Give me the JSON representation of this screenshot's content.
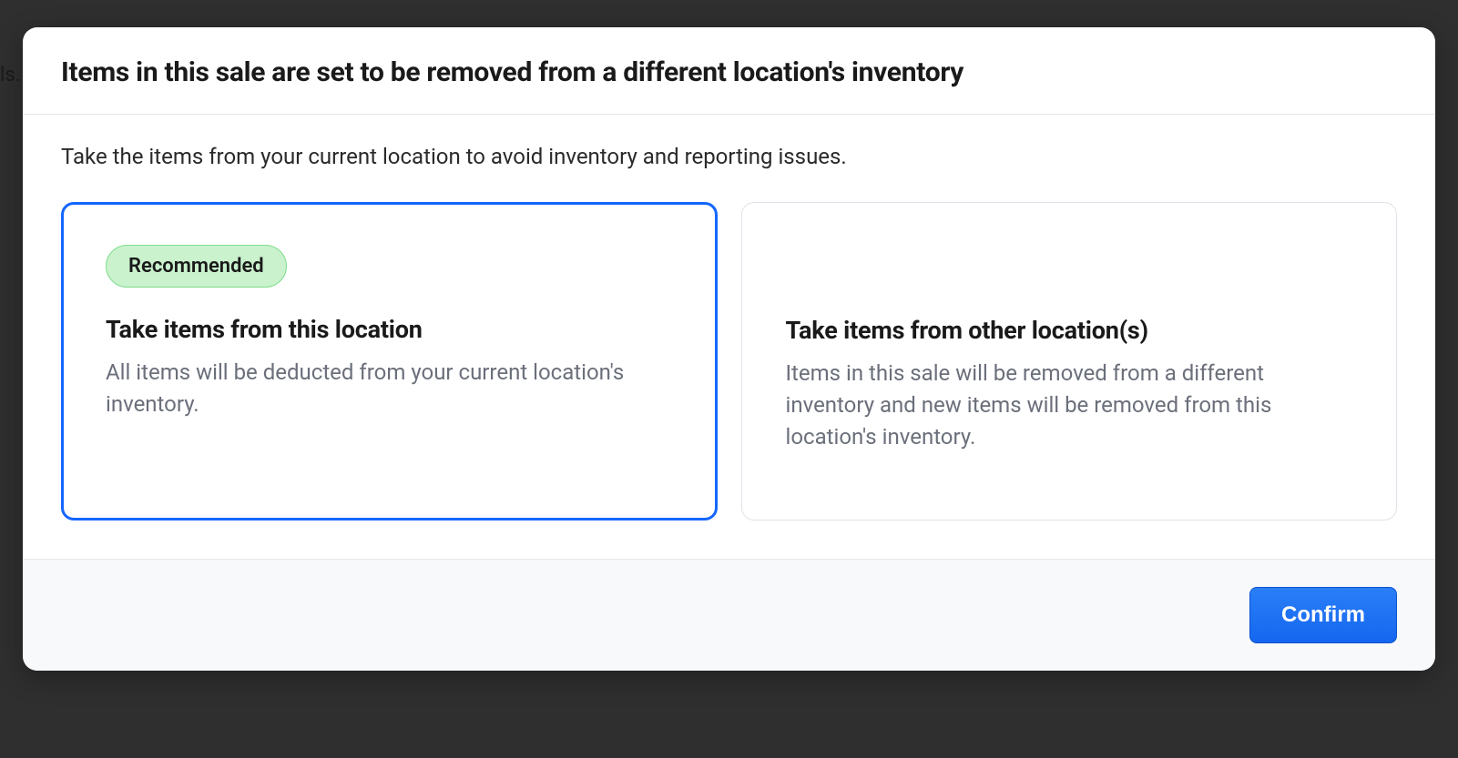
{
  "backdrop_snippet": "ls.",
  "modal": {
    "title": "Items in this sale are set to be removed from a different location's inventory",
    "subtitle": "Take the items from your current location to avoid inventory and reporting issues.",
    "options": [
      {
        "badge": "Recommended",
        "title": "Take items from this location",
        "desc": "All items will be deducted from your current location's inventory."
      },
      {
        "title": "Take items from other location(s)",
        "desc": "Items in this sale will be removed from a different inventory and new items will be removed from this location's inventory."
      }
    ],
    "confirm_label": "Confirm"
  }
}
